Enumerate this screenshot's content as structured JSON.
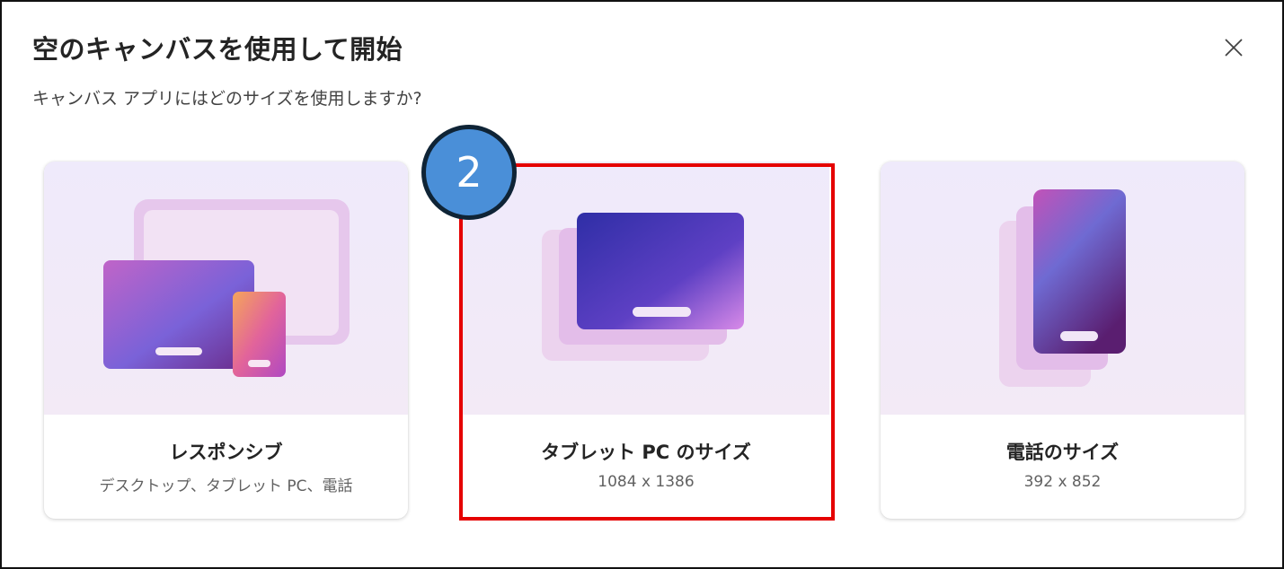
{
  "dialog": {
    "title": "空のキャンバスを使用して開始",
    "subtitle": "キャンバス アプリにはどのサイズを使用しますか?",
    "close_icon": "close-icon"
  },
  "cards": [
    {
      "id": "responsive",
      "title": "レスポンシブ",
      "description": "デスクトップ、タブレット PC、電話"
    },
    {
      "id": "tablet",
      "title": "タブレット PC のサイズ",
      "description": "1084 x 1386"
    },
    {
      "id": "phone",
      "title": "電話のサイズ",
      "description": "392 x 852"
    }
  ],
  "annotation": {
    "step_number": "2",
    "highlight_color": "#e50000",
    "badge_color": "#4a8fd8"
  }
}
